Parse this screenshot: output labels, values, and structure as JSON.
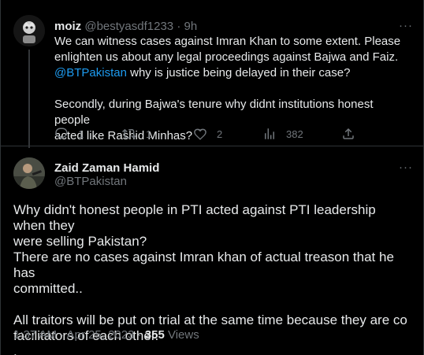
{
  "reply": {
    "author_name": "moiz",
    "author_handle": "@bestyasdf1233",
    "separator": "·",
    "time": "9h",
    "text_line1": "We can witness cases against Imran Khan to some extent. Please",
    "text_line2": "enlighten us about any legal proceedings against Bajwa and Faiz.",
    "mention": "@BTPakistan",
    "text_line3_rest": " why is justice being delayed in their case?",
    "text_line4": "Secondly, during Bajwa's tenure why didnt institutions honest people",
    "text_line5": "acted like Rashid Minhas?",
    "reply_count": "1",
    "retweet_count": "1",
    "like_count": "2",
    "view_count": "382",
    "more_label": "···"
  },
  "main": {
    "author_name": "Zaid Zaman Hamid",
    "author_handle": "@BTPakistan",
    "more_label": "···",
    "line1": "Why didn't honest people in PTI acted against PTI leadership when they",
    "line2": "were selling Pakistan?",
    "line3": "There are no cases against Imran khan of actual treason that he has",
    "line4": "committed..",
    "line5": "All traitors will be put on trial at the same time because they are co",
    "line6": "facilitators of each other.",
    "line7": ".",
    "timestamp": "1:37 AM · Apr 25, 2023 · ",
    "views_count": "355",
    "views_label": " Views"
  },
  "colors": {
    "background": "#000000",
    "text": "#e7e9ea",
    "muted": "#71767b",
    "link": "#1d9bf0",
    "border": "#2f3336"
  },
  "icons": [
    "reply-icon",
    "retweet-icon",
    "like-icon",
    "views-icon",
    "share-icon",
    "more-icon"
  ]
}
